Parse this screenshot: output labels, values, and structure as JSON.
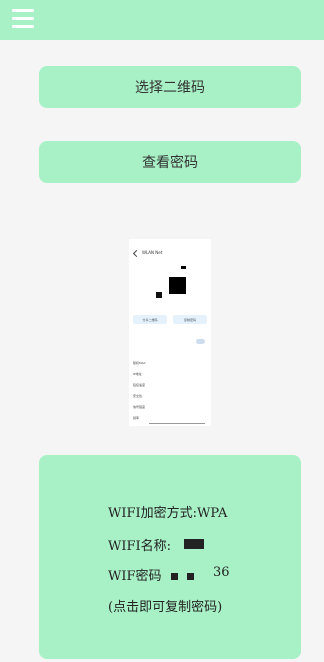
{
  "appbar": {
    "menu_icon": "menu-icon",
    "color": "#a8f1c6"
  },
  "buttons": {
    "select_qr_label": "选择二维码",
    "view_password_label": "查看密码"
  },
  "preview": {
    "title": "WLAN Net",
    "btn_left": "分享二维码",
    "btn_right": "复制密码",
    "rows": [
      {
        "label": "随机MAC",
        "value": ""
      },
      {
        "label": "IP地址",
        "value": ""
      },
      {
        "label": "链接速度",
        "value": ""
      },
      {
        "label": "安全性",
        "value": ""
      },
      {
        "label": "信号强度",
        "value": ""
      },
      {
        "label": "频率",
        "value": ""
      }
    ]
  },
  "info": {
    "encryption": "WIFI加密方式:WPA",
    "name": "WIFI名称:",
    "password": "WIF密码",
    "password_tail": "36",
    "hint": "(点击即可复制密码)"
  }
}
